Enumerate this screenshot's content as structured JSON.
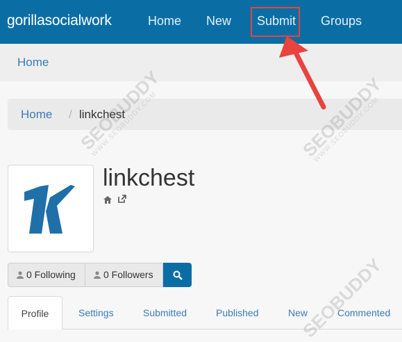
{
  "navbar": {
    "brand": "gorillasocialwork",
    "items": [
      {
        "label": "Home"
      },
      {
        "label": "New"
      },
      {
        "label": "Submit"
      },
      {
        "label": "Groups"
      }
    ]
  },
  "subnav": {
    "home": "Home"
  },
  "breadcrumb": {
    "home": "Home",
    "separator": "/",
    "current": "linkchest"
  },
  "profile": {
    "name": "linkchest",
    "icons": [
      "home-icon",
      "external-link-icon"
    ]
  },
  "follow": {
    "following": "0 Following",
    "followers": "0 Followers",
    "search_icon": "search-icon"
  },
  "tabs": [
    {
      "label": "Profile",
      "active": true
    },
    {
      "label": "Settings"
    },
    {
      "label": "Submitted"
    },
    {
      "label": "Published"
    },
    {
      "label": "New"
    },
    {
      "label": "Commented"
    }
  ],
  "watermark": {
    "text": "SEOBUDDY",
    "subtext": "WWW.SEOBUDDY.COM"
  },
  "colors": {
    "navbar": "#0a6ea5",
    "link": "#3a7cb8",
    "highlight": "#e8433f"
  }
}
